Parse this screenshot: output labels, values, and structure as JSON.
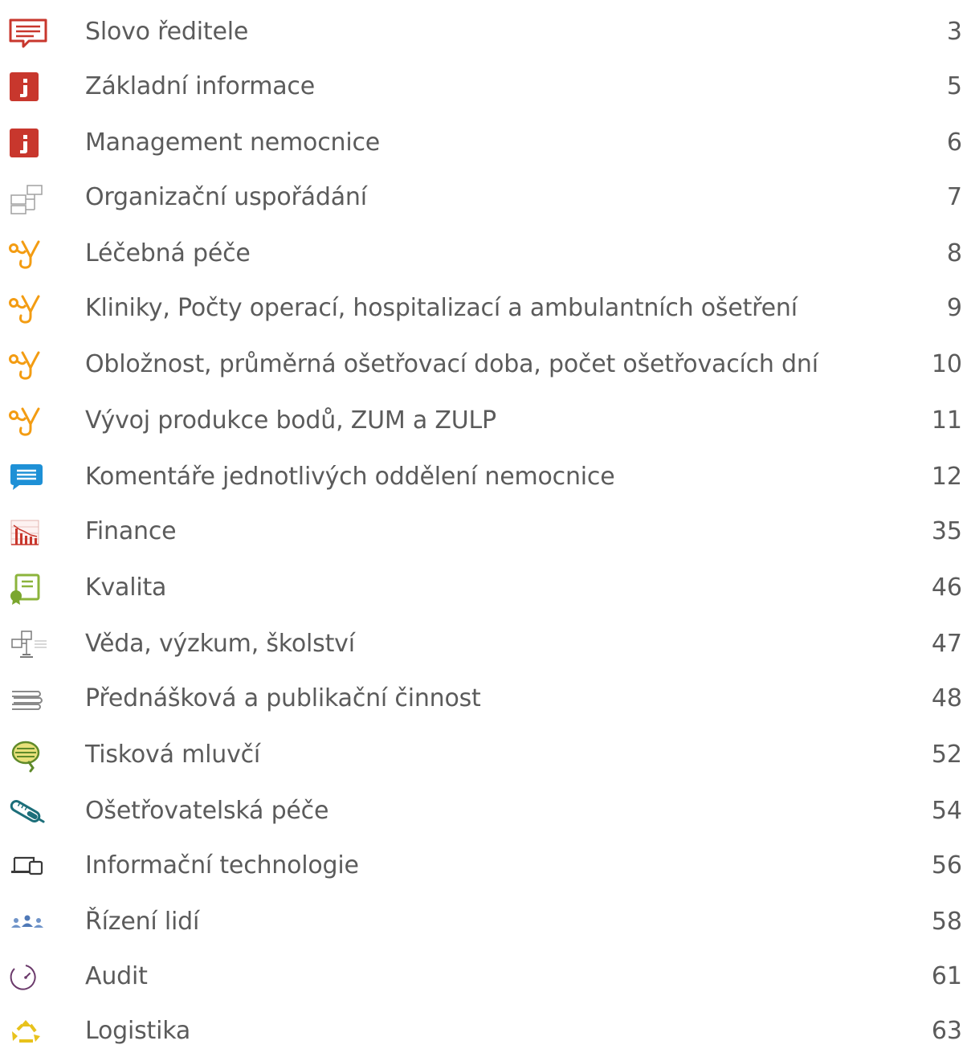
{
  "toc": {
    "items": [
      {
        "icon": "speech-bubble-icon",
        "title": "Slovo ředitele",
        "page": "3"
      },
      {
        "icon": "info-icon",
        "title": "Základní informace",
        "page": "5"
      },
      {
        "icon": "info-icon",
        "title": "Management nemocnice",
        "page": "6"
      },
      {
        "icon": "org-chart-icon",
        "title": "Organizační uspořádání",
        "page": "7"
      },
      {
        "icon": "stethoscope-icon",
        "title": "Léčebná péče",
        "page": "8"
      },
      {
        "icon": "stethoscope-icon",
        "title": "Kliniky, Počty operací, hospitalizací a ambulantních ošetření",
        "page": "9"
      },
      {
        "icon": "stethoscope-icon",
        "title": "Obložnost, průměrná ošetřovací doba, počet ošetřovacích dní",
        "page": "10"
      },
      {
        "icon": "stethoscope-icon",
        "title": "Vývoj produkce bodů, ZUM a ZULP",
        "page": "11"
      },
      {
        "icon": "chat-bubble-icon",
        "title": "Komentáře jednotlivých oddělení nemocnice",
        "page": "12"
      },
      {
        "icon": "finance-chart-icon",
        "title": "Finance",
        "page": "35"
      },
      {
        "icon": "certificate-icon",
        "title": "Kvalita",
        "page": "46"
      },
      {
        "icon": "science-diagram-icon",
        "title": "Věda, výzkum, školství",
        "page": "47"
      },
      {
        "icon": "books-icon",
        "title": "Přednášková a publikační činnost",
        "page": "48"
      },
      {
        "icon": "microphone-icon",
        "title": "Tisková mluvčí",
        "page": "52"
      },
      {
        "icon": "thermometer-icon",
        "title": "Ošetřovatelská péče",
        "page": "54"
      },
      {
        "icon": "devices-icon",
        "title": "Informační technologie",
        "page": "56"
      },
      {
        "icon": "people-icon",
        "title": "Řízení lidí",
        "page": "58"
      },
      {
        "icon": "gauge-icon",
        "title": "Audit",
        "page": "61"
      },
      {
        "icon": "recycle-icon",
        "title": "Logistika",
        "page": "63"
      }
    ]
  },
  "colors": {
    "text": "#5b5b5b",
    "red": "#c8372d",
    "orange": "#f39c12",
    "blue": "#1e90d6",
    "green": "#8cb43c",
    "teal": "#1d6f7a",
    "purple": "#6b3a6b",
    "yellow": "#e8c21c"
  }
}
